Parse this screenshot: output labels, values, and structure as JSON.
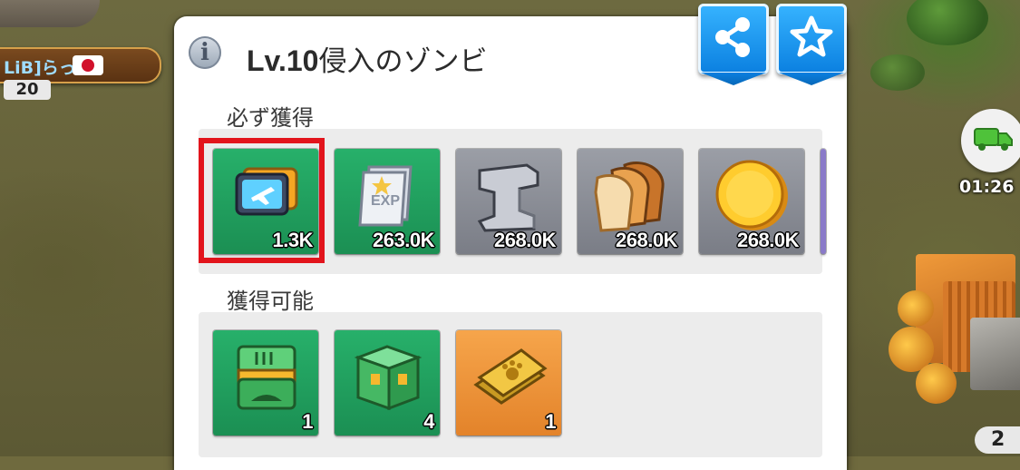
{
  "background": {
    "player": {
      "name": "LiB]らっ",
      "level": "20"
    },
    "truck_timer": "01:26",
    "corner_badge": "2"
  },
  "panel": {
    "title_level": "Lv.10",
    "title_name": "侵入のゾンビ",
    "share_button_icon": "share-icon",
    "favorite_button_icon": "star-icon",
    "sections": {
      "guaranteed": {
        "label": "必ず獲得",
        "items": [
          {
            "name": "aircraft-part-card",
            "qty": "1.3K",
            "bg": "#27b06a",
            "selected": true
          },
          {
            "name": "exp-book",
            "qty": "263.0K",
            "bg": "#27b06a"
          },
          {
            "name": "iron",
            "qty": "268.0K",
            "bg": "#9b9ea6"
          },
          {
            "name": "bread",
            "qty": "268.0K",
            "bg": "#9b9ea6"
          },
          {
            "name": "gold-coin",
            "qty": "268.0K",
            "bg": "#9b9ea6"
          }
        ]
      },
      "possible": {
        "label": "獲得可能",
        "items": [
          {
            "name": "green-supply-crate",
            "qty": "1",
            "bg": "#27b06a"
          },
          {
            "name": "green-chest",
            "qty": "4",
            "bg": "#27b06a"
          },
          {
            "name": "gold-paw-card",
            "qty": "1",
            "bg": "#f6a54b"
          }
        ]
      }
    }
  },
  "colors": {
    "highlight": "#e2141c",
    "header_button": "#1a99f0",
    "panel_bg": "#ffffff",
    "section_bg": "#ececec"
  }
}
